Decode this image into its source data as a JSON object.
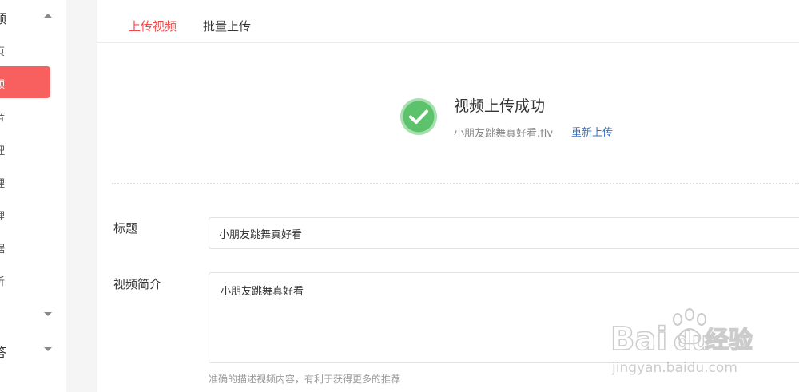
{
  "sidebar": {
    "group_video": {
      "label": "频",
      "caret": "caret-up"
    },
    "items": [
      {
        "label": "页",
        "active": false
      },
      {
        "label": "频",
        "active": true
      },
      {
        "label": "音",
        "active": false
      },
      {
        "label": "理",
        "active": false
      },
      {
        "label": "理",
        "active": false
      },
      {
        "label": "理",
        "active": false
      },
      {
        "label": "据",
        "active": false
      },
      {
        "label": "析",
        "active": false
      }
    ],
    "group_collapsed": {
      "label": "",
      "caret": "caret-down"
    },
    "group_qa": {
      "label": "答",
      "caret": "caret-down"
    }
  },
  "tabs": [
    {
      "label": "上传视频",
      "active": true
    },
    {
      "label": "批量上传",
      "active": false
    }
  ],
  "upload_status": {
    "icon": "check-circle-icon",
    "title": "视频上传成功",
    "filename": "小朋友跳舞真好看.flv",
    "reupload_label": "重新上传"
  },
  "form": {
    "title_label": "标题",
    "title_value": "小朋友跳舞真好看",
    "desc_label": "视频简介",
    "desc_value": "小朋友跳舞真好看",
    "desc_hint": "准确的描述视频内容，有利于获得更多的推荐"
  },
  "watermark": {
    "brand_latin_1": "Bai",
    "brand_latin_2": "du",
    "brand_cn": "经验",
    "url": "jingyan.baidu.com"
  },
  "colors": {
    "accent_red": "#f85f5f",
    "tab_active": "#f04b4b",
    "success_green": "#5cc26b",
    "link_blue": "#3a6fc0"
  }
}
